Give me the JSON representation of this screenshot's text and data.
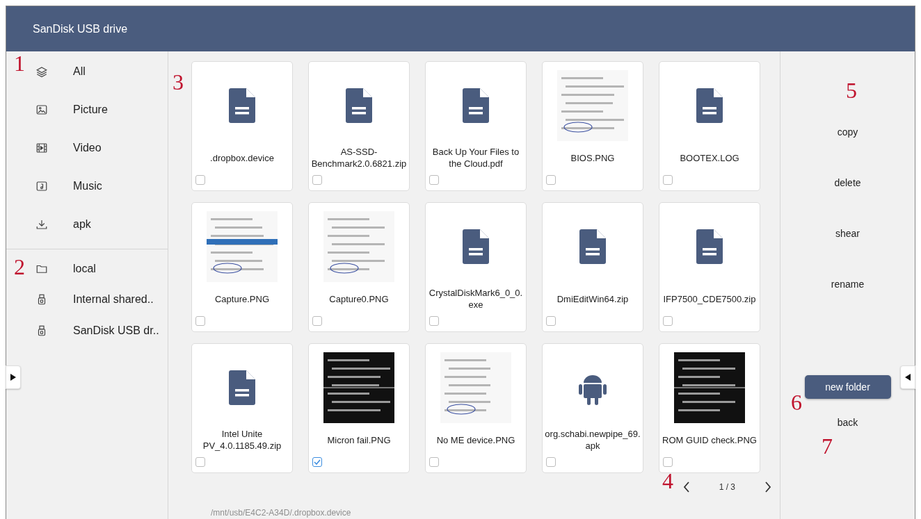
{
  "header": {
    "title": "SanDisk USB drive"
  },
  "sidebar": {
    "categories": [
      {
        "label": "All"
      },
      {
        "label": "Picture"
      },
      {
        "label": "Video"
      },
      {
        "label": "Music"
      },
      {
        "label": "apk"
      }
    ],
    "locations": [
      {
        "label": "local"
      },
      {
        "label": "Internal shared.."
      },
      {
        "label": "SanDisk USB dr.."
      }
    ]
  },
  "files": [
    {
      "name": ".dropbox.device",
      "kind": "document",
      "checked": false
    },
    {
      "name": "AS-SSD-Benchmark2.0.6821.zip",
      "kind": "document",
      "checked": false
    },
    {
      "name": "Back Up Your Files to the Cloud.pdf",
      "kind": "document",
      "checked": false
    },
    {
      "name": "BIOS.PNG",
      "kind": "picture",
      "checked": false
    },
    {
      "name": "BOOTEX.LOG",
      "kind": "document",
      "checked": false
    },
    {
      "name": "Capture.PNG",
      "kind": "picture",
      "checked": false
    },
    {
      "name": "Capture0.PNG",
      "kind": "picture",
      "checked": false
    },
    {
      "name": "CrystalDiskMark6_0_0.exe",
      "kind": "document",
      "checked": false
    },
    {
      "name": "DmiEditWin64.zip",
      "kind": "document",
      "checked": false
    },
    {
      "name": "IFP7500_CDE7500.zip",
      "kind": "document",
      "checked": false
    },
    {
      "name": "Intel Unite PV_4.0.1185.49.zip",
      "kind": "document",
      "checked": false
    },
    {
      "name": "Micron fail.PNG",
      "kind": "picture",
      "checked": true
    },
    {
      "name": "No ME device.PNG",
      "kind": "picture",
      "checked": false
    },
    {
      "name": "org.schabi.newpipe_69.apk",
      "kind": "android",
      "checked": false
    },
    {
      "name": "ROM GUID check.PNG",
      "kind": "picture",
      "checked": false
    }
  ],
  "pagination": {
    "page": "1 / 3"
  },
  "path": "/mnt/usb/E4C2-A34D/.dropbox.device",
  "actions": [
    "copy",
    "delete",
    "shear",
    "rename"
  ],
  "new_folder_button": "new folder",
  "back_button": "back",
  "callouts": [
    "1",
    "2",
    "3",
    "4",
    "5",
    "6",
    "7"
  ]
}
